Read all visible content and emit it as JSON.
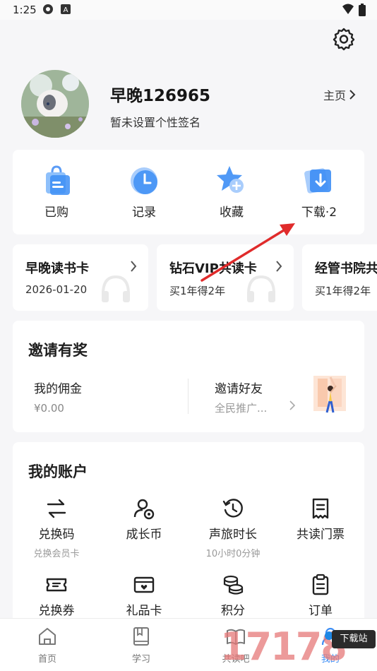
{
  "status_bar": {
    "time": "1:25",
    "icons": [
      "settings-gear-icon",
      "keyboard-a-icon",
      "wifi-icon",
      "battery-icon"
    ]
  },
  "profile": {
    "username": "早晚126965",
    "signature": "暂未设置个性签名",
    "home_link": "主页"
  },
  "quick_actions": [
    {
      "label": "已购",
      "icon": "shopping-bag-icon"
    },
    {
      "label": "记录",
      "icon": "clock-icon"
    },
    {
      "label": "收藏",
      "icon": "star-plus-icon"
    },
    {
      "label": "下载·2",
      "icon": "download-icon"
    }
  ],
  "vip_cards": [
    {
      "title": "早晚读书卡",
      "subtitle": "2026-01-20"
    },
    {
      "title": "钻石VIP共读卡",
      "subtitle": "买1年得2年"
    },
    {
      "title": "经管书院共",
      "subtitle": "买1年得2年"
    }
  ],
  "invite": {
    "title": "邀请有奖",
    "commission_label": "我的佣金",
    "commission_value": "¥0.00",
    "invite_label": "邀请好友",
    "invite_value": "全民推广..."
  },
  "account": {
    "title": "我的账户",
    "items": [
      {
        "label": "兑换码",
        "sub": "兑换会员卡",
        "icon": "swap-arrows-icon"
      },
      {
        "label": "成长币",
        "sub": "",
        "icon": "user-coin-icon"
      },
      {
        "label": "声旅时长",
        "sub": "10小时0分钟",
        "icon": "history-clock-icon"
      },
      {
        "label": "共读门票",
        "sub": "",
        "icon": "receipt-icon"
      },
      {
        "label": "兑换券",
        "sub": "",
        "icon": "ticket-icon"
      },
      {
        "label": "礼品卡",
        "sub": "",
        "icon": "gift-card-icon"
      },
      {
        "label": "积分",
        "sub": "",
        "icon": "coins-stack-icon"
      },
      {
        "label": "订单",
        "sub": "",
        "icon": "clipboard-icon"
      }
    ]
  },
  "tabs": [
    {
      "label": "首页",
      "icon": "home-icon"
    },
    {
      "label": "学习",
      "icon": "book-icon"
    },
    {
      "label": "共读吧",
      "icon": "reading-icon"
    },
    {
      "label": "我的",
      "icon": "user-icon"
    }
  ],
  "watermark": {
    "text": "17178",
    "badge": "下载站"
  },
  "colors": {
    "accent_blue": "#3d8ef5",
    "annotation_arrow": "#e02b2b",
    "background": "#f6f6f8"
  }
}
